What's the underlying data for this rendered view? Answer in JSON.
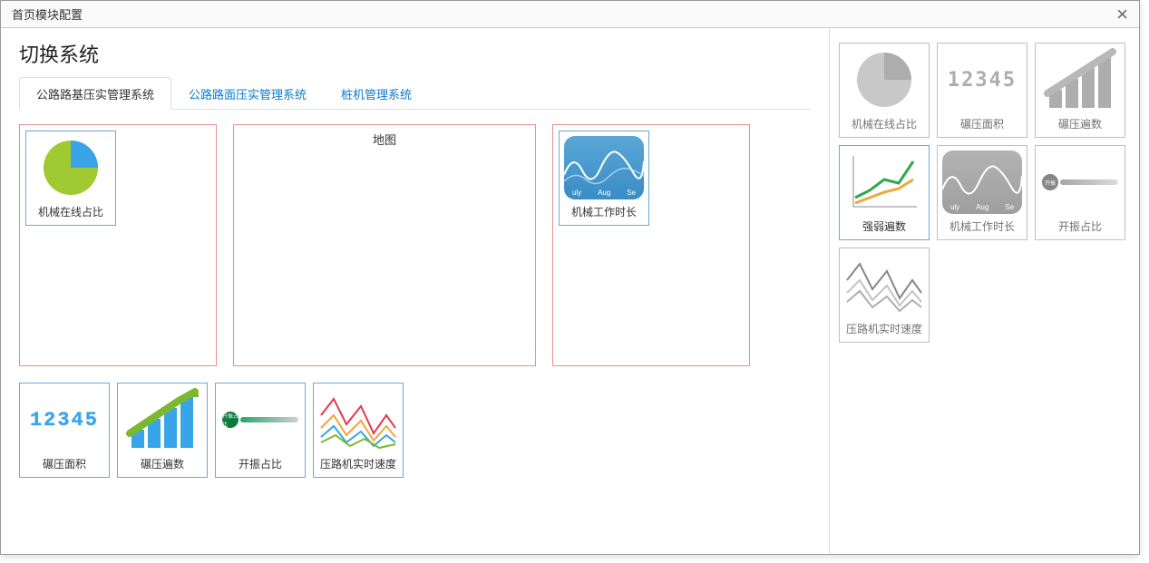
{
  "dialog": {
    "title": "首页模块配置"
  },
  "section_title": "切换系统",
  "tabs": [
    {
      "label": "公路路基压实管理系统",
      "active": true
    },
    {
      "label": "公路路面压实管理系统",
      "active": false
    },
    {
      "label": "桩机管理系统",
      "active": false
    }
  ],
  "zone_b_label": "地图",
  "months": [
    "uly",
    "Aug",
    "Se"
  ],
  "modules_left": {
    "zone_a": {
      "label": "机械在线占比",
      "icon": "pie"
    },
    "zone_c": {
      "label": "机械工作时长",
      "icon": "wave"
    },
    "bottom": [
      {
        "label": "碾压面积",
        "icon": "digits"
      },
      {
        "label": "碾压遍数",
        "icon": "barchart"
      },
      {
        "label": "开振占比",
        "icon": "gauge"
      },
      {
        "label": "压路机实时速度",
        "icon": "multiline"
      }
    ]
  },
  "modules_right": [
    {
      "label": "机械在线占比",
      "icon": "pie",
      "disabled": true
    },
    {
      "label": "碾压面积",
      "icon": "digits",
      "disabled": true
    },
    {
      "label": "碾压遍数",
      "icon": "barchart",
      "disabled": true
    },
    {
      "label": "强弱遍数",
      "icon": "trendup",
      "disabled": false
    },
    {
      "label": "机械工作时长",
      "icon": "wave",
      "disabled": true
    },
    {
      "label": "开振占比",
      "icon": "gauge",
      "disabled": true
    },
    {
      "label": "压路机实时速度",
      "icon": "multiline",
      "disabled": true
    }
  ],
  "digit_sample": "12345"
}
